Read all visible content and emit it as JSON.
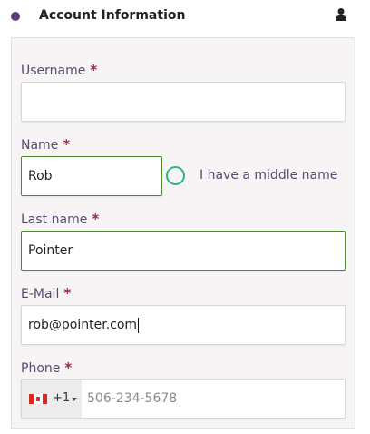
{
  "header": {
    "title": "Account Information",
    "accent_color": "#5a3a7a",
    "icon": "user-icon"
  },
  "form": {
    "required_marker": "*",
    "username": {
      "label": "Username",
      "value": ""
    },
    "name": {
      "label": "Name",
      "value": "Rob"
    },
    "middle_name_toggle": {
      "label": "I have a middle name",
      "checked": false
    },
    "last_name": {
      "label": "Last name",
      "value": "Pointer"
    },
    "email": {
      "label": "E-Mail",
      "value": "rob@pointer.com"
    },
    "phone": {
      "label": "Phone",
      "country_flag": "canada-flag-icon",
      "dial_code": "+1",
      "placeholder": "506-234-5678",
      "value": ""
    }
  },
  "colors": {
    "label": "#5a4a72",
    "required": "#b01e3a",
    "valid_border": "#4f8a2e",
    "toggle": "#2db38c"
  }
}
